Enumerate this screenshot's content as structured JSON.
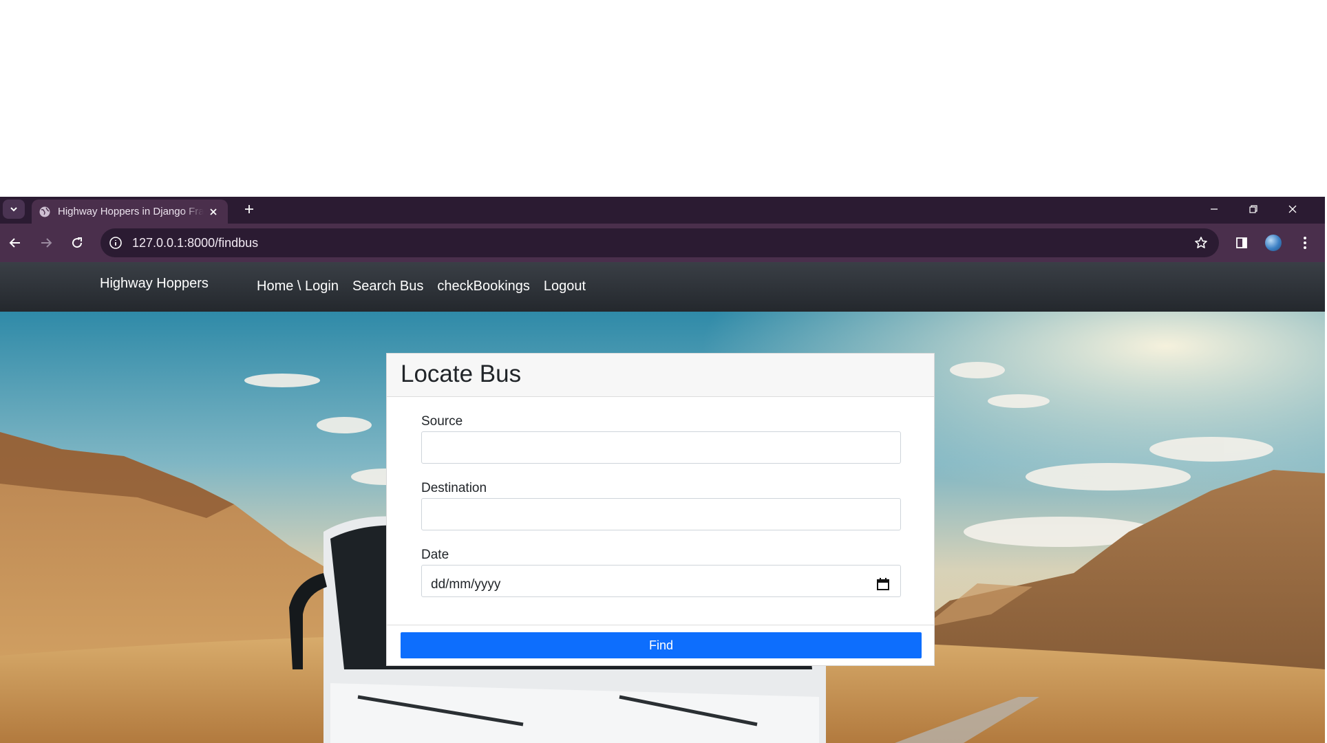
{
  "browser": {
    "tab_title": "Highway Hoppers in Django Framework",
    "url": "127.0.0.1:8000/findbus"
  },
  "navbar": {
    "brand": "Highway Hoppers",
    "links": [
      "Home \\ Login",
      "Search Bus",
      "checkBookings",
      "Logout"
    ]
  },
  "form": {
    "title": "Locate Bus",
    "source_label": "Source",
    "source_value": "",
    "destination_label": "Destination",
    "destination_value": "",
    "date_label": "Date",
    "date_placeholder": "dd/mm/yyyy",
    "submit_label": "Find"
  },
  "colors": {
    "browser_frame": "#2b1b32",
    "browser_toolbar": "#4a2f4c",
    "navbar": "#2c3036",
    "primary_button": "#0d6efd"
  },
  "icons": [
    "tab-search-icon",
    "globe-icon",
    "close-icon",
    "plus-icon",
    "minimize-icon",
    "restore-icon",
    "back-icon",
    "forward-icon",
    "reload-icon",
    "info-icon",
    "star-icon",
    "side-panel-icon",
    "profile-avatar",
    "kebab-menu-icon",
    "calendar-icon"
  ]
}
